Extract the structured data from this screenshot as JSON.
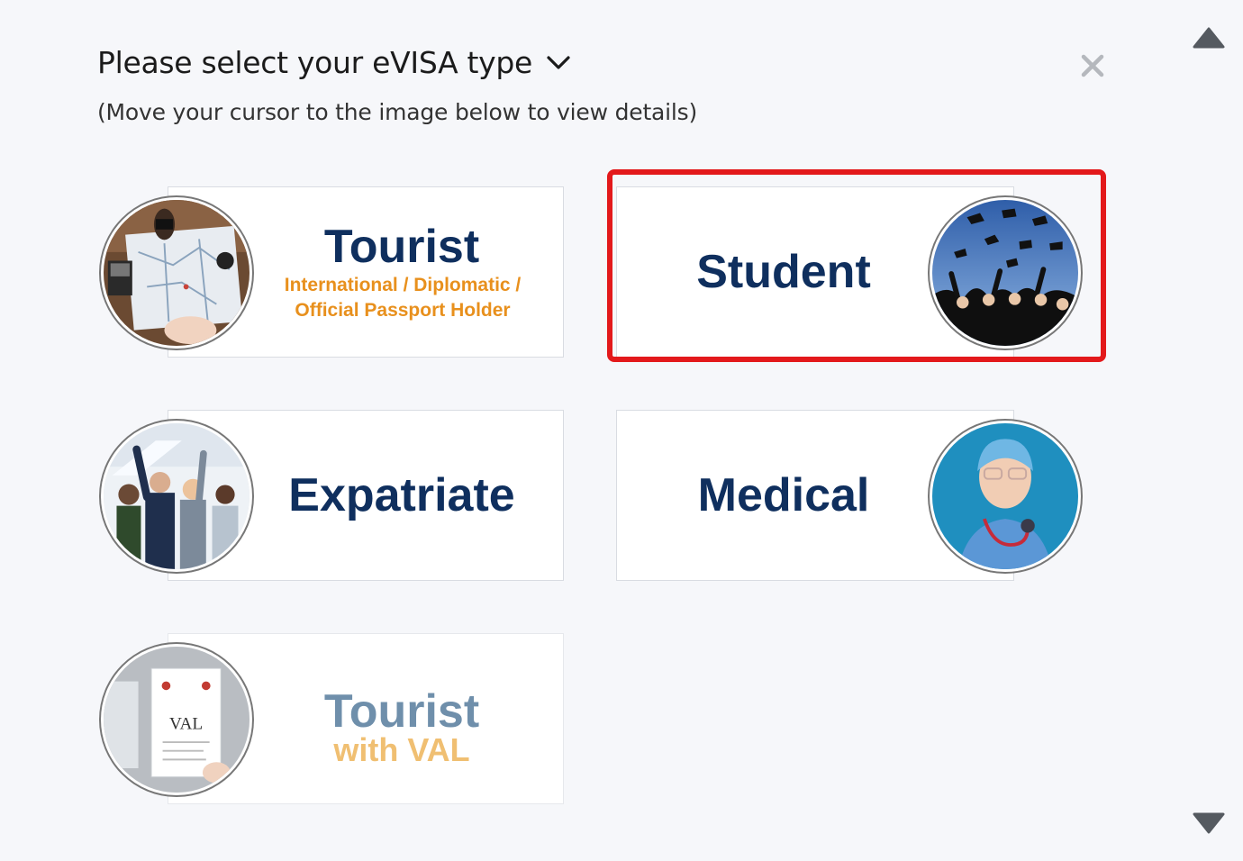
{
  "header": {
    "title": "Please select your eVISA type",
    "subtitle": "(Move your cursor to the image below to view details)"
  },
  "icons": {
    "close": "close-icon",
    "dropdown": "chevron-down-icon",
    "scroll_up": "triangle-up-icon",
    "scroll_down": "triangle-down-icon"
  },
  "colors": {
    "title_blue": "#0f2f5e",
    "subtitle_orange": "#e8901d",
    "highlight_red": "#e3191b",
    "faded_blue": "#6f8fab",
    "faded_orange": "#f0bf72"
  },
  "visa_types": {
    "tourist": {
      "label": "Tourist",
      "sub": "International / Diplomatic / Official Passport Holder"
    },
    "student": {
      "label": "Student",
      "highlighted": true
    },
    "expatriate": {
      "label": "Expatriate"
    },
    "medical": {
      "label": "Medical"
    },
    "tourist_val": {
      "label": "Tourist",
      "sub": "with VAL",
      "image_text": "VAL"
    }
  }
}
